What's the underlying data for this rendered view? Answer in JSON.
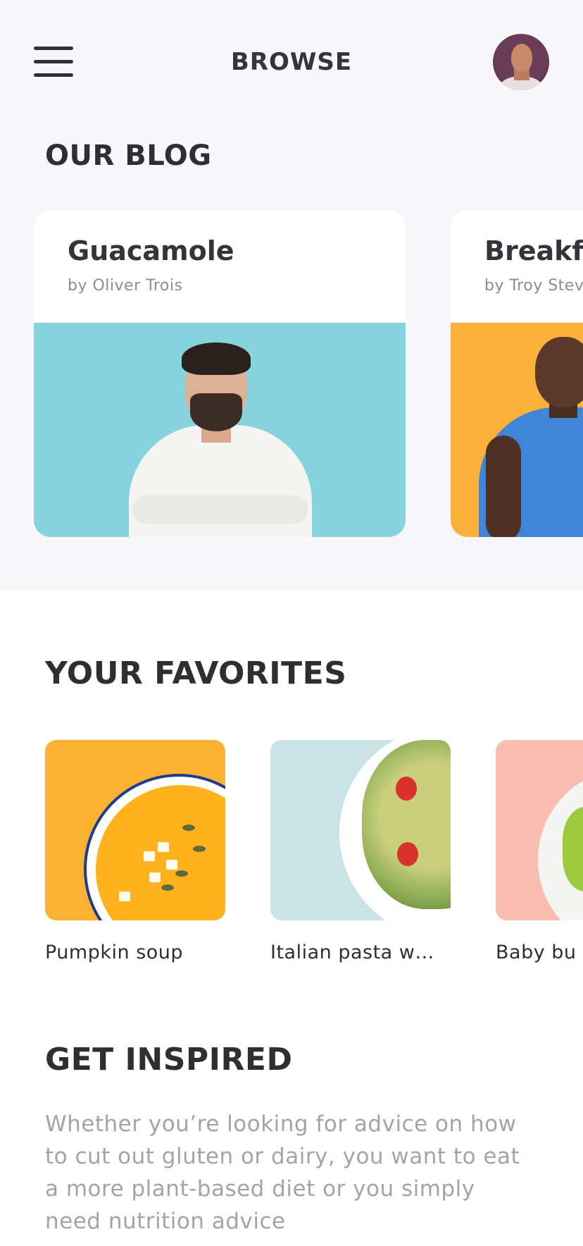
{
  "header": {
    "title": "BROWSE",
    "menu_icon": "hamburger-menu-icon",
    "avatar_icon": "user-avatar"
  },
  "blog": {
    "heading": "OUR BLOG",
    "cards": [
      {
        "title": "Guacamole",
        "author": "by Oliver Trois",
        "bg_color": "#86d3de"
      },
      {
        "title": "Breakfast",
        "author": "by Troy Stevens",
        "bg_color": "#fbb13a"
      }
    ]
  },
  "favorites": {
    "heading": "YOUR FAVORITES",
    "items": [
      {
        "label": "Pumpkin soup",
        "bg_color": "#fbb233"
      },
      {
        "label": "Italian pasta w…",
        "bg_color": "#c9e3e6"
      },
      {
        "label": "Baby bu",
        "bg_color": "#f8bdb0"
      }
    ]
  },
  "inspire": {
    "heading": "GET INSPIRED",
    "text": "Whether you’re looking for advice on how to cut out gluten or dairy, you want to eat a more plant-based diet or you simply need nutrition advice"
  },
  "colors": {
    "background_top": "#f7f7f9",
    "text_dark": "#2f2f33",
    "text_muted": "#a3a3a8"
  }
}
